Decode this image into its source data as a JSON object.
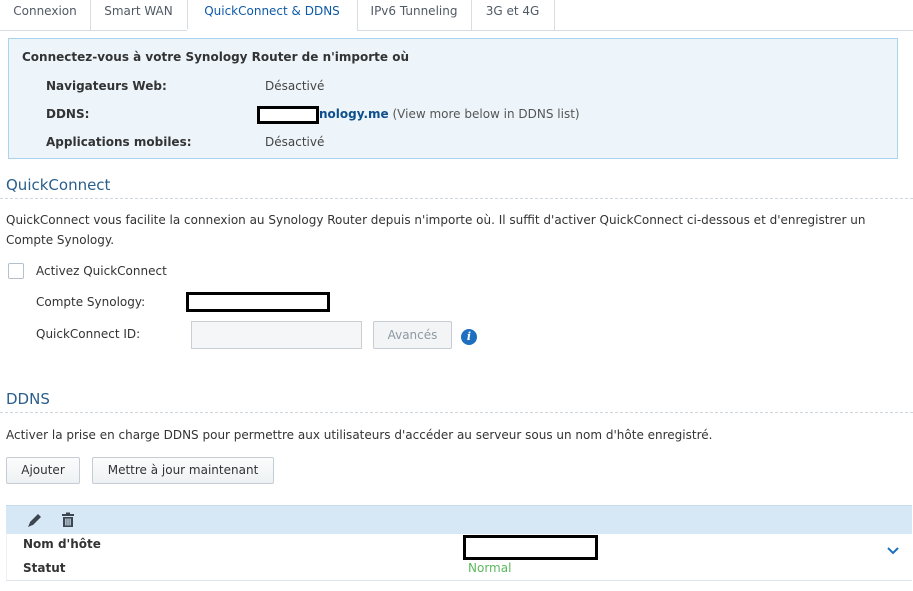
{
  "tabs": [
    {
      "label": "Connexion"
    },
    {
      "label": "Smart WAN"
    },
    {
      "label": "QuickConnect & DDNS"
    },
    {
      "label": "IPv6 Tunneling"
    },
    {
      "label": "3G et 4G"
    }
  ],
  "active_tab": "QuickConnect & DDNS",
  "info": {
    "title": "Connectez-vous à votre Synology Router de n'importe où",
    "web_label": "Navigateurs Web:",
    "web_value": "Désactivé",
    "ddns_label": "DDNS:",
    "ddns_host_visible": "nology.me",
    "ddns_note": "(View more below in DDNS list)",
    "mobile_label": "Applications mobiles:",
    "mobile_value": "Désactivé"
  },
  "quickconnect": {
    "title": "QuickConnect",
    "description": "QuickConnect vous facilite la connexion au Synology Router depuis n'importe où. Il suffit d'activer QuickConnect ci-dessous et d'enregistrer un Compte Synology.",
    "enable_label": "Activez QuickConnect",
    "enabled": false,
    "account_label": "Compte Synology:",
    "id_label": "QuickConnect ID:",
    "id_value": "",
    "advanced_label": "Avancés"
  },
  "ddns": {
    "title": "DDNS",
    "description": "Activer la prise en charge DDNS pour permettre aux utilisateurs d'accéder au serveur sous un nom d'hôte enregistré.",
    "add_label": "Ajouter",
    "update_label": "Mettre à jour maintenant",
    "hostname_label": "Nom d'hôte",
    "status_label": "Statut",
    "status_value": "Normal"
  },
  "colors": {
    "accent": "#0e5aa7",
    "info_bg": "#edf5fb",
    "toolbar_bg": "#d6e8f6",
    "status_ok": "#5cb85c"
  },
  "icons": [
    "pencil-icon",
    "trash-icon",
    "info-icon",
    "chevron-down-icon"
  ]
}
